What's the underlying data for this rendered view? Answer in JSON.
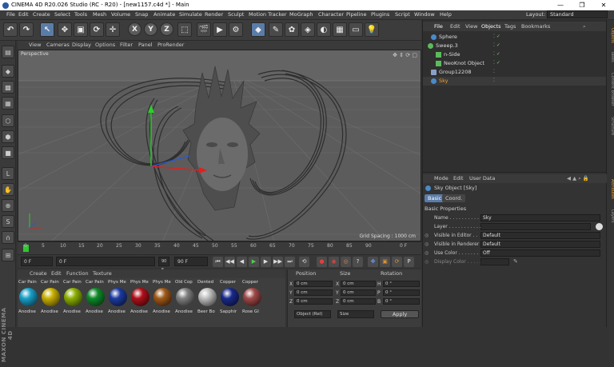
{
  "window": {
    "title": "CINEMA 4D R20.026 Studio (RC - R20) - [new1157.c4d *] - Main",
    "minimize": "—",
    "maximize": "❐",
    "close": "✕"
  },
  "menubar": {
    "items": [
      "File",
      "Edit",
      "Create",
      "Select",
      "Tools",
      "Mesh",
      "Volume",
      "Snap",
      "Animate",
      "Simulate",
      "Render",
      "Sculpt",
      "Motion Tracker",
      "MoGraph",
      "Character",
      "Pipeline",
      "Plugins",
      "Script",
      "Window",
      "Help"
    ],
    "layout_label": "Layout:",
    "layout_value": "Standard"
  },
  "toolbar": {
    "axis_labels": [
      "X",
      "Y",
      "Z"
    ]
  },
  "viewport": {
    "menu": [
      "View",
      "Cameras",
      "Display",
      "Options",
      "Filter",
      "Panel",
      "ProRender"
    ],
    "camera": "Perspective",
    "grid_spacing": "Grid Spacing : 1000 cm"
  },
  "timeline": {
    "ticks": [
      "0",
      "5",
      "10",
      "15",
      "20",
      "25",
      "30",
      "35",
      "40",
      "45",
      "50",
      "55",
      "60",
      "65",
      "70",
      "75",
      "80",
      "85",
      "90"
    ],
    "end_frame": "0 F",
    "start_field": "0 F",
    "current_field": "0 F",
    "end_field": "90 F",
    "max_field": "90 F"
  },
  "materials": {
    "menu": [
      "Create",
      "Edit",
      "Function",
      "Texture"
    ],
    "items": [
      {
        "name": "Car Pain",
        "label": "Anodise",
        "color": "#1aa0c8"
      },
      {
        "name": "Car Pain",
        "label": "Anodise",
        "color": "#c8b000"
      },
      {
        "name": "Car Pain",
        "label": "Anodise",
        "color": "#8db000"
      },
      {
        "name": "Car Pain",
        "label": "Anodise",
        "color": "#0f8a2a"
      },
      {
        "name": "Phys Me",
        "label": "Anodise",
        "color": "#1d3aa0"
      },
      {
        "name": "Phys Me",
        "label": "Anodise",
        "color": "#b0101a"
      },
      {
        "name": "Phys Me",
        "label": "Anodise",
        "color": "#a05a1a"
      },
      {
        "name": "Old Cop",
        "label": "Anodise",
        "color": "#808080"
      },
      {
        "name": "Dented",
        "label": "Beer Bo",
        "color": "#bfbfbf"
      },
      {
        "name": "Copper",
        "label": "Sapphir",
        "color": "#1a2a8a"
      },
      {
        "name": "Copper",
        "label": "Rose Gl",
        "color": "#a04a4a"
      }
    ]
  },
  "coordinates": {
    "headers": [
      "Position",
      "Size",
      "Rotation"
    ],
    "rows": [
      {
        "axis": "X",
        "pos": "0 cm",
        "size_axis": "X",
        "size": "0 cm",
        "rot_axis": "H",
        "rot": "0 °"
      },
      {
        "axis": "Y",
        "pos": "0 cm",
        "size_axis": "Y",
        "size": "0 cm",
        "rot_axis": "P",
        "rot": "0 °"
      },
      {
        "axis": "Z",
        "pos": "0 cm",
        "size_axis": "Z",
        "size": "0 cm",
        "rot_axis": "B",
        "rot": "0 °"
      }
    ],
    "mode": "Object (Rel)",
    "size_mode": "Size",
    "apply": "Apply"
  },
  "objects": {
    "tabs": [
      "File",
      "Edit",
      "View",
      "Objects",
      "Tags",
      "Bookmarks"
    ],
    "items": [
      {
        "name": "Sphere",
        "indent": 0,
        "color": "#4a8ac8"
      },
      {
        "name": "Sweep.3",
        "indent": 0,
        "color": "#5cba5c"
      },
      {
        "name": "n-Side",
        "indent": 1,
        "color": "#5cba5c"
      },
      {
        "name": "NeoKnot Object",
        "indent": 1,
        "color": "#5cba5c"
      },
      {
        "name": "Group12208",
        "indent": 0,
        "color": "#8aa0c8"
      },
      {
        "name": "Sky",
        "indent": 0,
        "color": "#4a8ac8"
      }
    ]
  },
  "attributes": {
    "menu": [
      "Mode",
      "Edit",
      "User Data"
    ],
    "object_title": "Sky Object [Sky]",
    "tabs": [
      "Basic",
      "Coord."
    ],
    "section": "Basic Properties",
    "props": [
      {
        "label": "Name . . . . . . . . . . . . .",
        "value": "Sky"
      },
      {
        "label": "Layer . . . . . . . . . . . . .",
        "value": ""
      },
      {
        "label": "Visible in Editor . .",
        "value": "Default"
      },
      {
        "label": "Visible in Renderer",
        "value": "Default"
      },
      {
        "label": "Use Color . . . . . . . .",
        "value": "Off"
      },
      {
        "label": "Display Color . . . . .",
        "value": ""
      }
    ]
  },
  "right_tabs": [
    "Objects",
    "Takes",
    "Content Browser",
    "Structure",
    "Attributes",
    "Layers"
  ],
  "branding": "MAXON CINEMA 4D"
}
